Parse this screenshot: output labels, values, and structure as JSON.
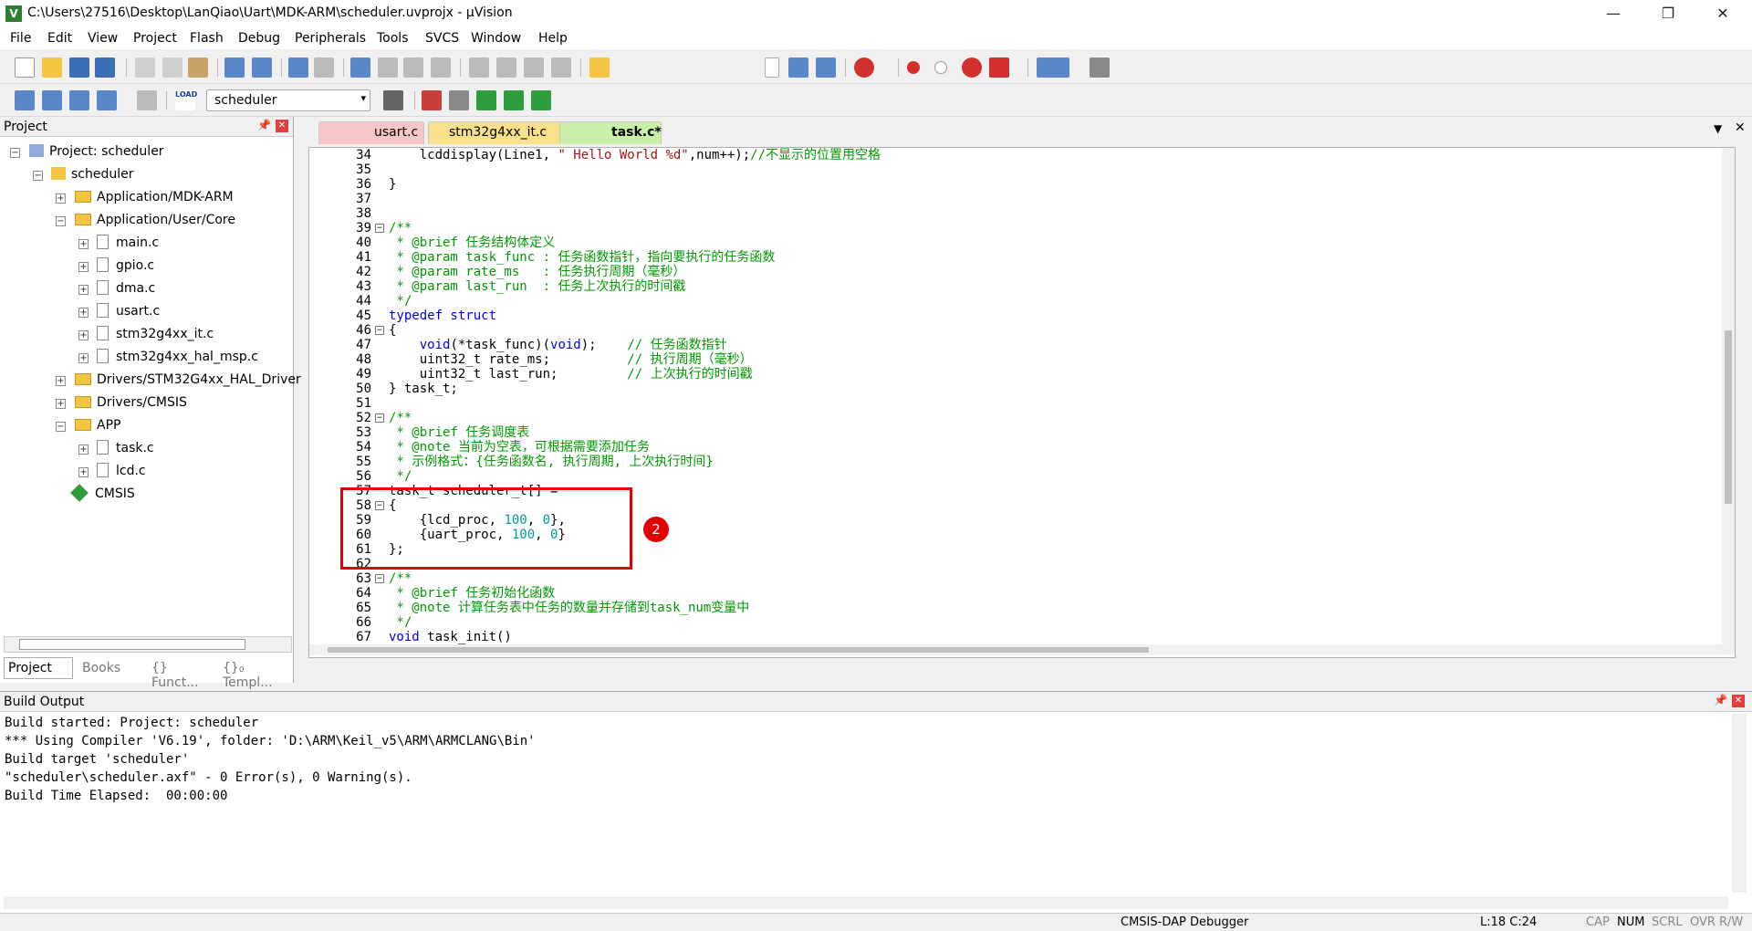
{
  "window": {
    "title": "C:\\Users\\27516\\Desktop\\LanQiao\\Uart\\MDK-ARM\\scheduler.uvprojx - µVision",
    "min": "—",
    "max": "❐",
    "close": "✕"
  },
  "menu": [
    "File",
    "Edit",
    "View",
    "Project",
    "Flash",
    "Debug",
    "Peripherals",
    "Tools",
    "SVCS",
    "Window",
    "Help"
  ],
  "toolbar2": {
    "target": "scheduler",
    "load_label": "LOAD"
  },
  "project": {
    "header": "Project",
    "root": "Project: scheduler",
    "target": "scheduler",
    "groups": [
      {
        "label": "Application/MDK-ARM"
      },
      {
        "label": "Application/User/Core"
      },
      {
        "label": "main.c"
      },
      {
        "label": "gpio.c"
      },
      {
        "label": "dma.c"
      },
      {
        "label": "usart.c"
      },
      {
        "label": "stm32g4xx_it.c"
      },
      {
        "label": "stm32g4xx_hal_msp.c"
      },
      {
        "label": "Drivers/STM32G4xx_HAL_Driver"
      },
      {
        "label": "Drivers/CMSIS"
      },
      {
        "label": "APP"
      },
      {
        "label": "task.c"
      },
      {
        "label": "lcd.c"
      },
      {
        "label": "CMSIS"
      }
    ],
    "bottom_tabs": [
      "Project",
      "Books",
      "{} Funct...",
      "{}₀ Templ..."
    ]
  },
  "tabs": [
    {
      "label": "usart.c",
      "color": "#f7c6c6"
    },
    {
      "label": "stm32g4xx_it.c",
      "color": "#f9e08a"
    },
    {
      "label": "task.c*",
      "color": "#c8f0a8"
    }
  ],
  "code": {
    "lines": [
      {
        "n": "34",
        "t": "    lcddisplay(Line1, \" Hello World %d\",num++);//不显示的位置用空格"
      },
      {
        "n": "35",
        "t": ""
      },
      {
        "n": "36",
        "t": "}"
      },
      {
        "n": "37",
        "t": ""
      },
      {
        "n": "38",
        "t": ""
      },
      {
        "n": "39",
        "t": "/**"
      },
      {
        "n": "40",
        "t": " * @brief 任务结构体定义"
      },
      {
        "n": "41",
        "t": " * @param task_func : 任务函数指针，指向要执行的任务函数"
      },
      {
        "n": "42",
        "t": " * @param rate_ms   : 任务执行周期（毫秒）"
      },
      {
        "n": "43",
        "t": " * @param last_run  : 任务上次执行的时间戳"
      },
      {
        "n": "44",
        "t": " */"
      },
      {
        "n": "45",
        "t": "typedef struct"
      },
      {
        "n": "46",
        "t": "{"
      },
      {
        "n": "47",
        "t": "    void(*task_func)(void);    // 任务函数指针"
      },
      {
        "n": "48",
        "t": "    uint32_t rate_ms;          // 执行周期（毫秒）"
      },
      {
        "n": "49",
        "t": "    uint32_t last_run;         // 上次执行的时间戳"
      },
      {
        "n": "50",
        "t": "} task_t;"
      },
      {
        "n": "51",
        "t": ""
      },
      {
        "n": "52",
        "t": "/**"
      },
      {
        "n": "53",
        "t": " * @brief 任务调度表"
      },
      {
        "n": "54",
        "t": " * @note 当前为空表，可根据需要添加任务"
      },
      {
        "n": "55",
        "t": " * 示例格式：{任务函数名, 执行周期, 上次执行时间}"
      },
      {
        "n": "56",
        "t": " */"
      },
      {
        "n": "57",
        "t": "task_t scheduler_t[] ="
      },
      {
        "n": "58",
        "t": "{"
      },
      {
        "n": "59",
        "t": "    {lcd_proc, 100, 0},"
      },
      {
        "n": "60",
        "t": "    {uart_proc, 100, 0}"
      },
      {
        "n": "61",
        "t": "};"
      },
      {
        "n": "62",
        "t": ""
      },
      {
        "n": "63",
        "t": "/**"
      },
      {
        "n": "64",
        "t": " * @brief 任务初始化函数"
      },
      {
        "n": "65",
        "t": " * @note 计算任务表中任务的数量并存储到task_num变量中"
      },
      {
        "n": "66",
        "t": " */"
      },
      {
        "n": "67",
        "t": "void task_init()"
      }
    ],
    "annotation_badge": "2"
  },
  "build": {
    "header": "Build Output",
    "lines": [
      "Build started: Project: scheduler",
      "*** Using Compiler 'V6.19', folder: 'D:\\ARM\\Keil_v5\\ARM\\ARMCLANG\\Bin'",
      "Build target 'scheduler'",
      "\"scheduler\\scheduler.axf\" - 0 Error(s), 0 Warning(s).",
      "Build Time Elapsed:  00:00:00"
    ]
  },
  "status": {
    "debugger": "CMSIS-DAP Debugger",
    "position": "L:18 C:24",
    "cap": "CAP",
    "num": "NUM",
    "scrl": "SCRL",
    "ovr": "OVR",
    "rw": "R/W"
  },
  "colors": {
    "comment": "#009900",
    "keyword": "#0000e6",
    "number": "#009999",
    "string": "#a31515",
    "highlight_box": "#e00000"
  }
}
